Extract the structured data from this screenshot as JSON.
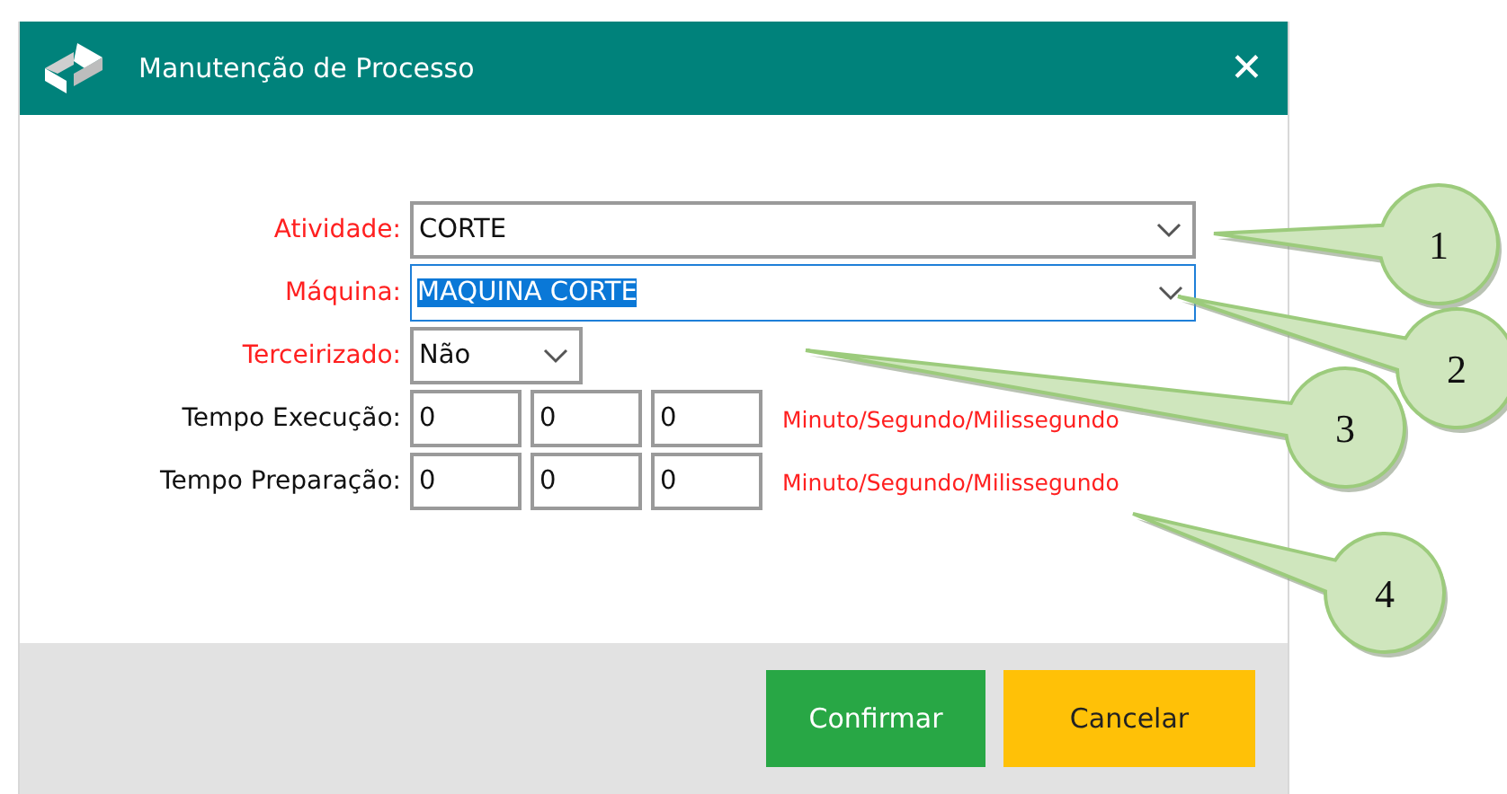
{
  "window": {
    "title": "Manutenção de Processo",
    "close": "✕"
  },
  "form": [
    {
      "kind": "combo",
      "label": "Atividade:",
      "required": true,
      "value": "CORTE",
      "focused": false,
      "wide": true
    },
    {
      "kind": "combo",
      "label": "Máquina:",
      "required": true,
      "value": "MAQUINA CORTE",
      "focused": true,
      "wide": true
    },
    {
      "kind": "combo",
      "label": "Terceirizado:",
      "required": true,
      "value": "Não",
      "focused": false,
      "wide": false
    },
    {
      "kind": "time",
      "label": "Tempo Execução:",
      "required": false,
      "values": [
        "0",
        "0",
        "0"
      ],
      "hint": "Minuto/Segundo/Milissegundo"
    },
    {
      "kind": "time",
      "label": "Tempo Preparação:",
      "required": false,
      "values": [
        "0",
        "0",
        "0"
      ],
      "hint": "Minuto/Segundo/Milissegundo"
    }
  ],
  "buttons": [
    {
      "kind": "confirm",
      "label": "Confirmar"
    },
    {
      "kind": "cancel",
      "label": "Cancelar"
    }
  ],
  "callouts": [
    "1",
    "2",
    "3",
    "4"
  ]
}
